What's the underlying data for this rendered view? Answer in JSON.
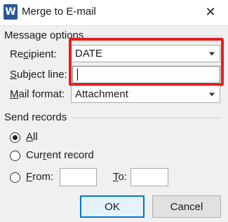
{
  "window": {
    "title": "Merge to E-mail",
    "app_icon_letter": "W",
    "close_glyph": "✕"
  },
  "message_options": {
    "group_label": "Message options",
    "recipient": {
      "label_pre": "Re",
      "label_u": "c",
      "label_post": "ipient:",
      "value": "DATE"
    },
    "subject": {
      "label_u": "S",
      "label_post": "ubject line:",
      "value": ""
    },
    "mail_format": {
      "label_u": "M",
      "label_post": "ail format:",
      "value": "Attachment"
    }
  },
  "send_records": {
    "group_label": "Send records",
    "all": {
      "label_u": "A",
      "label_post": "ll",
      "checked": true
    },
    "current": {
      "label_pre": "Cur",
      "label_u": "r",
      "label_post": "ent record",
      "checked": false
    },
    "from": {
      "label_u": "F",
      "label_post": "rom:",
      "checked": false,
      "value": ""
    },
    "to": {
      "label_u": "T",
      "label_post": "o:",
      "value": ""
    }
  },
  "buttons": {
    "ok": "OK",
    "cancel": "Cancel"
  },
  "colors": {
    "highlight": "#e81c1c",
    "default_button_border": "#0078d7",
    "app_icon": "#2b579a"
  }
}
